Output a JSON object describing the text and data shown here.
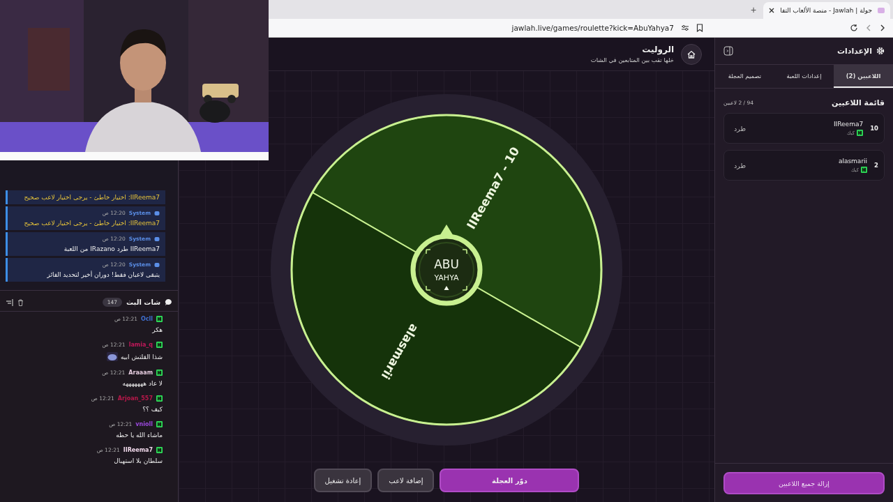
{
  "browser": {
    "tab": {
      "title": "جولة | Jawlah - منصة الألعاب التفا"
    },
    "new_tab": "+",
    "url": "jawlah.live/games/roulette?kick=AbuYahya7"
  },
  "system_messages": [
    {
      "text": "IIReema7: اختيار خاطئ - يرجى اختيار لاعب صحيح",
      "color": "#e8c53a"
    },
    {
      "sender": "System",
      "time": "12:20 ص",
      "text": "IIReema7: اختيار خاطئ - يرجى اختيار لاعب صحيح",
      "color": "#e8c53a"
    },
    {
      "sender": "System",
      "time": "12:20 ص",
      "text": "IIReema7 طرد IRazano من اللعبة",
      "color": "#f0f0f0"
    },
    {
      "sender": "System",
      "time": "12:20 ص",
      "text": "يتبقى لاعبان فقط! دوران أخير لتحديد الفائز",
      "color": "#f0f0f0"
    }
  ],
  "chat": {
    "title": "شات البث",
    "count": "147",
    "messages": [
      {
        "user": "Ocll",
        "color": "#3f6fd0",
        "time": "12:21 ص",
        "text": "هكر"
      },
      {
        "user": "lamia_q",
        "color": "#c0185a",
        "time": "12:21 ص",
        "text": "شذا القلتش ابيه",
        "emote": true
      },
      {
        "user": "Araaam",
        "color": "#e6cde0",
        "time": "12:21 ص",
        "text": "لا عاد هههههههه"
      },
      {
        "user": "Arjoan_557",
        "color": "#b8184a",
        "time": "12:21 ص",
        "text": "كيف ؟؟"
      },
      {
        "user": "vnioll",
        "color": "#9a48dc",
        "time": "12:21 ص",
        "text": "ماشاء الله يا حظه"
      },
      {
        "user": "IIReema7",
        "color": "#f0d8ea",
        "time": "12:21 ص",
        "text": "سلطان بلا استهبال"
      }
    ]
  },
  "game": {
    "title": "الروليت",
    "subtitle": "خلها تقب بين المتابعين في الشات",
    "wheel": {
      "segments": [
        {
          "label": "IIReema7 - 10",
          "color": "#1f4510"
        },
        {
          "label": "alasmarii",
          "color": "#15330a"
        }
      ],
      "center_logo": [
        "ABU",
        "YAHYA"
      ]
    },
    "buttons": [
      {
        "label": "دوّر العجلة",
        "kind": "primary"
      },
      {
        "label": "إضافة لاعب",
        "kind": "secondary"
      },
      {
        "label": "إعادة تشغيل",
        "kind": "secondary"
      }
    ]
  },
  "settings": {
    "title": "الإعدادات",
    "tabs": [
      {
        "label": "اللاعبين (2)",
        "selected": true
      },
      {
        "label": "إعدادات اللعبة",
        "selected": false
      },
      {
        "label": "تصميم العجلة",
        "selected": false
      }
    ],
    "list_title": "قائمة اللاعبين",
    "list_count": "94 / 2 لاعبين",
    "players": [
      {
        "score": "10",
        "name": "IIReema7",
        "platform": "كيك",
        "action": "طرد"
      },
      {
        "score": "2",
        "name": "alasmarii",
        "platform": "كيك",
        "action": "طرد"
      }
    ],
    "clear_button": "إزالة جميع اللاعبين"
  }
}
